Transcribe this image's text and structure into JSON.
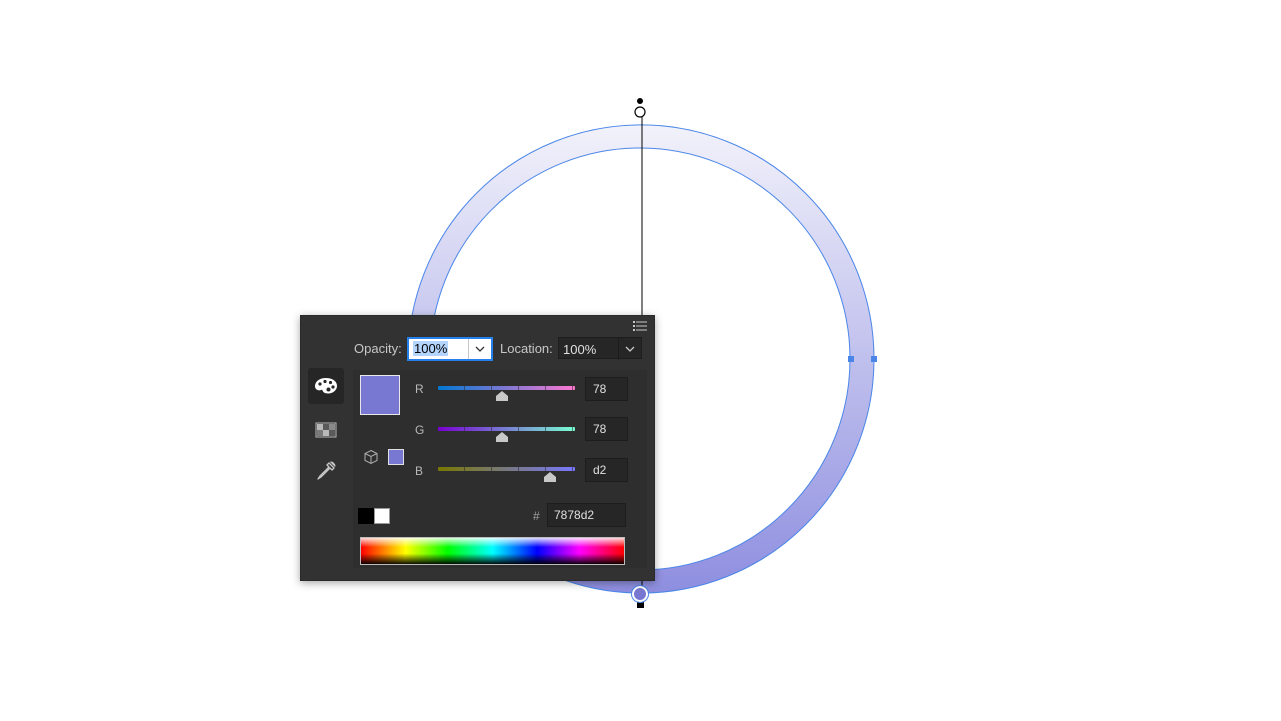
{
  "colors": {
    "selected_color": "#7878d2",
    "ring_top": "#f2f2fb",
    "ring_bottom": "#8e8ee0",
    "outline": "#4a86e8",
    "panel_bg": "#323232",
    "accent": "#2680eb"
  },
  "panel": {
    "menu_icon": "panel-menu-icon",
    "opacity_label": "Opacity:",
    "opacity_value": "100%",
    "location_label": "Location:",
    "location_value": "100%",
    "tools": [
      {
        "name": "color-palette-icon",
        "active": true
      },
      {
        "name": "swatches-grid-icon",
        "active": false
      },
      {
        "name": "eyedropper-icon",
        "active": false
      }
    ],
    "out_of_gamut_icon": "cube-icon",
    "channels": [
      {
        "label": "R",
        "value": "78",
        "fraction": 0.47
      },
      {
        "label": "G",
        "value": "78",
        "fraction": 0.47
      },
      {
        "label": "B",
        "value": "d2",
        "fraction": 0.82
      }
    ],
    "hash_label": "#",
    "hex_value": "7878d2"
  }
}
